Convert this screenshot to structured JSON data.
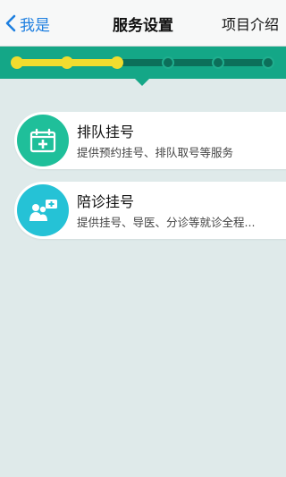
{
  "navbar": {
    "back_label": "我是",
    "title": "服务设置",
    "right_label": "项目介绍"
  },
  "progress": {
    "total_steps": 6,
    "completed_steps": 3,
    "done_color": "#f1dc2e",
    "band_color": "#14a787"
  },
  "services": [
    {
      "title": "排队挂号",
      "description": "提供预约挂号、排队取号等服务",
      "icon": "calendar-plus-icon",
      "icon_color": "#1fbf9a"
    },
    {
      "title": "陪诊挂号",
      "description": "提供挂号、导医、分诊等就诊全程...",
      "icon": "medical-escort-icon",
      "icon_color": "#25c2d6"
    }
  ]
}
